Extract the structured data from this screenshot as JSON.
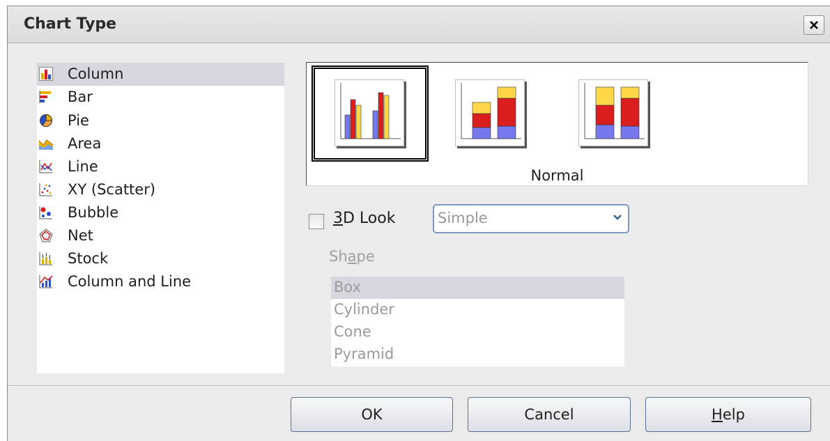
{
  "dialog": {
    "title": "Chart Type",
    "close_label": "×"
  },
  "chart_types": [
    {
      "label": "Column",
      "icon": "column-chart-icon",
      "selected": true
    },
    {
      "label": "Bar",
      "icon": "bar-chart-icon",
      "selected": false
    },
    {
      "label": "Pie",
      "icon": "pie-chart-icon",
      "selected": false
    },
    {
      "label": "Area",
      "icon": "area-chart-icon",
      "selected": false
    },
    {
      "label": "Line",
      "icon": "line-chart-icon",
      "selected": false
    },
    {
      "label": "XY (Scatter)",
      "icon": "scatter-chart-icon",
      "selected": false
    },
    {
      "label": "Bubble",
      "icon": "bubble-chart-icon",
      "selected": false
    },
    {
      "label": "Net",
      "icon": "net-chart-icon",
      "selected": false
    },
    {
      "label": "Stock",
      "icon": "stock-chart-icon",
      "selected": false
    },
    {
      "label": "Column and Line",
      "icon": "column-line-chart-icon",
      "selected": false
    }
  ],
  "variants": {
    "items": [
      {
        "icon": "normal-column-icon",
        "selected": true
      },
      {
        "icon": "stacked-column-icon",
        "selected": false
      },
      {
        "icon": "percent-stacked-column-icon",
        "selected": false
      }
    ],
    "caption": "Normal"
  },
  "look3d": {
    "checked": false,
    "label_mnemonic": "3",
    "label_rest": "D Look",
    "combo_value": "Simple"
  },
  "shape": {
    "label_pre": "Sh",
    "label_mnemonic": "a",
    "label_post": "pe",
    "options": [
      {
        "label": "Box",
        "selected": true
      },
      {
        "label": "Cylinder",
        "selected": false
      },
      {
        "label": "Cone",
        "selected": false
      },
      {
        "label": "Pyramid",
        "selected": false
      }
    ]
  },
  "buttons": {
    "ok": "OK",
    "cancel": "Cancel",
    "help_mnemonic": "H",
    "help_rest": "elp"
  },
  "colors": {
    "selection": "#d6d6df",
    "blue": "#7777ee",
    "red": "#d81e1e",
    "yellow": "#ffd84a"
  }
}
